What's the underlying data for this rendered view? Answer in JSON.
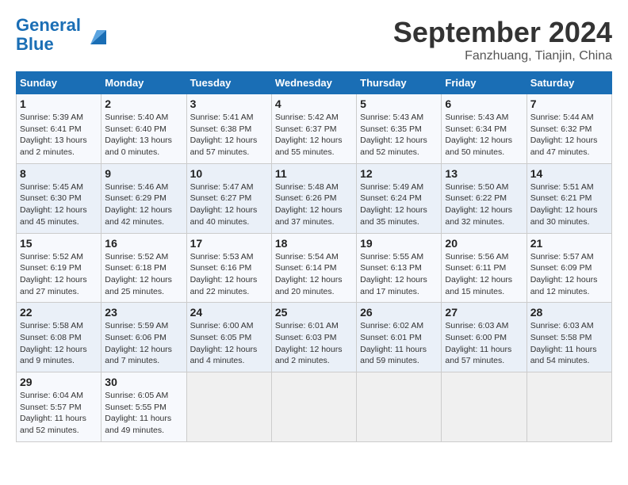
{
  "header": {
    "logo_line1": "General",
    "logo_line2": "Blue",
    "month": "September 2024",
    "location": "Fanzhuang, Tianjin, China"
  },
  "weekdays": [
    "Sunday",
    "Monday",
    "Tuesday",
    "Wednesday",
    "Thursday",
    "Friday",
    "Saturday"
  ],
  "weeks": [
    [
      {
        "day": "1",
        "sunrise": "Sunrise: 5:39 AM",
        "sunset": "Sunset: 6:41 PM",
        "daylight": "Daylight: 13 hours and 2 minutes."
      },
      {
        "day": "2",
        "sunrise": "Sunrise: 5:40 AM",
        "sunset": "Sunset: 6:40 PM",
        "daylight": "Daylight: 13 hours and 0 minutes."
      },
      {
        "day": "3",
        "sunrise": "Sunrise: 5:41 AM",
        "sunset": "Sunset: 6:38 PM",
        "daylight": "Daylight: 12 hours and 57 minutes."
      },
      {
        "day": "4",
        "sunrise": "Sunrise: 5:42 AM",
        "sunset": "Sunset: 6:37 PM",
        "daylight": "Daylight: 12 hours and 55 minutes."
      },
      {
        "day": "5",
        "sunrise": "Sunrise: 5:43 AM",
        "sunset": "Sunset: 6:35 PM",
        "daylight": "Daylight: 12 hours and 52 minutes."
      },
      {
        "day": "6",
        "sunrise": "Sunrise: 5:43 AM",
        "sunset": "Sunset: 6:34 PM",
        "daylight": "Daylight: 12 hours and 50 minutes."
      },
      {
        "day": "7",
        "sunrise": "Sunrise: 5:44 AM",
        "sunset": "Sunset: 6:32 PM",
        "daylight": "Daylight: 12 hours and 47 minutes."
      }
    ],
    [
      {
        "day": "8",
        "sunrise": "Sunrise: 5:45 AM",
        "sunset": "Sunset: 6:30 PM",
        "daylight": "Daylight: 12 hours and 45 minutes."
      },
      {
        "day": "9",
        "sunrise": "Sunrise: 5:46 AM",
        "sunset": "Sunset: 6:29 PM",
        "daylight": "Daylight: 12 hours and 42 minutes."
      },
      {
        "day": "10",
        "sunrise": "Sunrise: 5:47 AM",
        "sunset": "Sunset: 6:27 PM",
        "daylight": "Daylight: 12 hours and 40 minutes."
      },
      {
        "day": "11",
        "sunrise": "Sunrise: 5:48 AM",
        "sunset": "Sunset: 6:26 PM",
        "daylight": "Daylight: 12 hours and 37 minutes."
      },
      {
        "day": "12",
        "sunrise": "Sunrise: 5:49 AM",
        "sunset": "Sunset: 6:24 PM",
        "daylight": "Daylight: 12 hours and 35 minutes."
      },
      {
        "day": "13",
        "sunrise": "Sunrise: 5:50 AM",
        "sunset": "Sunset: 6:22 PM",
        "daylight": "Daylight: 12 hours and 32 minutes."
      },
      {
        "day": "14",
        "sunrise": "Sunrise: 5:51 AM",
        "sunset": "Sunset: 6:21 PM",
        "daylight": "Daylight: 12 hours and 30 minutes."
      }
    ],
    [
      {
        "day": "15",
        "sunrise": "Sunrise: 5:52 AM",
        "sunset": "Sunset: 6:19 PM",
        "daylight": "Daylight: 12 hours and 27 minutes."
      },
      {
        "day": "16",
        "sunrise": "Sunrise: 5:52 AM",
        "sunset": "Sunset: 6:18 PM",
        "daylight": "Daylight: 12 hours and 25 minutes."
      },
      {
        "day": "17",
        "sunrise": "Sunrise: 5:53 AM",
        "sunset": "Sunset: 6:16 PM",
        "daylight": "Daylight: 12 hours and 22 minutes."
      },
      {
        "day": "18",
        "sunrise": "Sunrise: 5:54 AM",
        "sunset": "Sunset: 6:14 PM",
        "daylight": "Daylight: 12 hours and 20 minutes."
      },
      {
        "day": "19",
        "sunrise": "Sunrise: 5:55 AM",
        "sunset": "Sunset: 6:13 PM",
        "daylight": "Daylight: 12 hours and 17 minutes."
      },
      {
        "day": "20",
        "sunrise": "Sunrise: 5:56 AM",
        "sunset": "Sunset: 6:11 PM",
        "daylight": "Daylight: 12 hours and 15 minutes."
      },
      {
        "day": "21",
        "sunrise": "Sunrise: 5:57 AM",
        "sunset": "Sunset: 6:09 PM",
        "daylight": "Daylight: 12 hours and 12 minutes."
      }
    ],
    [
      {
        "day": "22",
        "sunrise": "Sunrise: 5:58 AM",
        "sunset": "Sunset: 6:08 PM",
        "daylight": "Daylight: 12 hours and 9 minutes."
      },
      {
        "day": "23",
        "sunrise": "Sunrise: 5:59 AM",
        "sunset": "Sunset: 6:06 PM",
        "daylight": "Daylight: 12 hours and 7 minutes."
      },
      {
        "day": "24",
        "sunrise": "Sunrise: 6:00 AM",
        "sunset": "Sunset: 6:05 PM",
        "daylight": "Daylight: 12 hours and 4 minutes."
      },
      {
        "day": "25",
        "sunrise": "Sunrise: 6:01 AM",
        "sunset": "Sunset: 6:03 PM",
        "daylight": "Daylight: 12 hours and 2 minutes."
      },
      {
        "day": "26",
        "sunrise": "Sunrise: 6:02 AM",
        "sunset": "Sunset: 6:01 PM",
        "daylight": "Daylight: 11 hours and 59 minutes."
      },
      {
        "day": "27",
        "sunrise": "Sunrise: 6:03 AM",
        "sunset": "Sunset: 6:00 PM",
        "daylight": "Daylight: 11 hours and 57 minutes."
      },
      {
        "day": "28",
        "sunrise": "Sunrise: 6:03 AM",
        "sunset": "Sunset: 5:58 PM",
        "daylight": "Daylight: 11 hours and 54 minutes."
      }
    ],
    [
      {
        "day": "29",
        "sunrise": "Sunrise: 6:04 AM",
        "sunset": "Sunset: 5:57 PM",
        "daylight": "Daylight: 11 hours and 52 minutes."
      },
      {
        "day": "30",
        "sunrise": "Sunrise: 6:05 AM",
        "sunset": "Sunset: 5:55 PM",
        "daylight": "Daylight: 11 hours and 49 minutes."
      },
      null,
      null,
      null,
      null,
      null
    ]
  ]
}
